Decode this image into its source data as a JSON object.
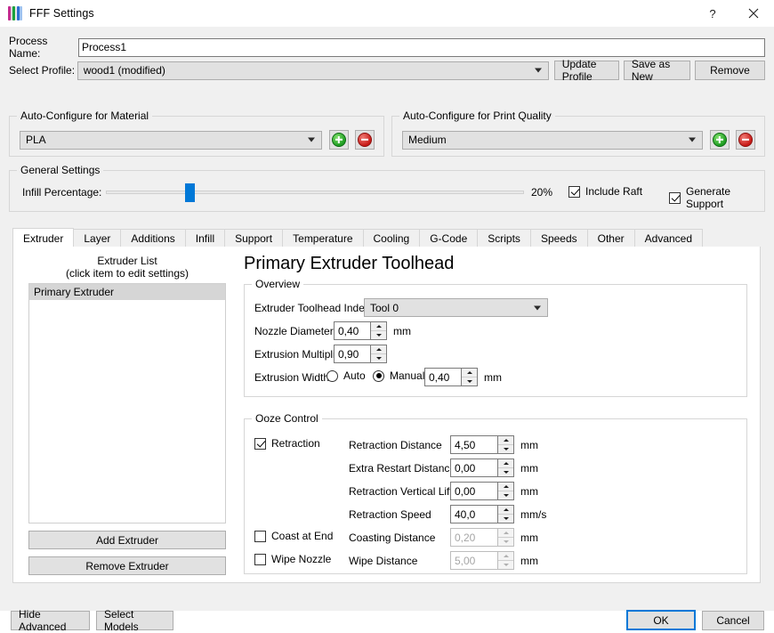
{
  "window": {
    "title": "FFF Settings",
    "app_icon": "fff-stripes-icon",
    "help_label": "?",
    "close_label": "✕"
  },
  "header": {
    "process_name_label": "Process Name:",
    "process_name_value": "Process1",
    "select_profile_label": "Select Profile:",
    "select_profile_value": "wood1 (modified)",
    "update_profile_label": "Update Profile",
    "save_as_new_label": "Save as New",
    "remove_label": "Remove"
  },
  "material_group": {
    "legend": "Auto-Configure for Material",
    "value": "PLA",
    "add_label": "+",
    "remove_label": "−"
  },
  "quality_group": {
    "legend": "Auto-Configure for Print Quality",
    "value": "Medium",
    "add_label": "+",
    "remove_label": "−"
  },
  "general_group": {
    "legend": "General Settings",
    "infill_label": "Infill Percentage:",
    "infill_value": "20%",
    "infill_percent": 20,
    "include_raft_label": "Include Raft",
    "include_raft_checked": true,
    "generate_support_label": "Generate Support",
    "generate_support_checked": true
  },
  "tabs": [
    {
      "label": "Extruder",
      "active": true
    },
    {
      "label": "Layer",
      "active": false
    },
    {
      "label": "Additions",
      "active": false
    },
    {
      "label": "Infill",
      "active": false
    },
    {
      "label": "Support",
      "active": false
    },
    {
      "label": "Temperature",
      "active": false
    },
    {
      "label": "Cooling",
      "active": false
    },
    {
      "label": "G-Code",
      "active": false
    },
    {
      "label": "Scripts",
      "active": false
    },
    {
      "label": "Speeds",
      "active": false
    },
    {
      "label": "Other",
      "active": false
    },
    {
      "label": "Advanced",
      "active": false
    }
  ],
  "extruder_list": {
    "title": "Extruder List",
    "subtitle": "(click item to edit settings)",
    "items": [
      {
        "label": "Primary Extruder",
        "selected": true
      }
    ],
    "add_label": "Add Extruder",
    "remove_label": "Remove Extruder"
  },
  "panel": {
    "title": "Primary Extruder Toolhead",
    "overview": {
      "legend": "Overview",
      "toolhead_index_label": "Extruder Toolhead Index",
      "toolhead_index_value": "Tool 0",
      "nozzle_diameter_label": "Nozzle Diameter",
      "nozzle_diameter_value": "0,40",
      "nozzle_diameter_unit": "mm",
      "extrusion_multiplier_label": "Extrusion Multiplier",
      "extrusion_multiplier_value": "0,90",
      "extrusion_width_label": "Extrusion Width",
      "extrusion_width_auto_label": "Auto",
      "extrusion_width_manual_label": "Manual",
      "extrusion_width_mode": "Manual",
      "extrusion_width_value": "0,40",
      "extrusion_width_unit": "mm"
    },
    "ooze": {
      "legend": "Ooze Control",
      "retraction_label": "Retraction",
      "retraction_checked": true,
      "retraction_distance_label": "Retraction Distance",
      "retraction_distance_value": "4,50",
      "retraction_distance_unit": "mm",
      "extra_restart_label": "Extra Restart Distance",
      "extra_restart_value": "0,00",
      "extra_restart_unit": "mm",
      "vertical_lift_label": "Retraction Vertical Lift",
      "vertical_lift_value": "0,00",
      "vertical_lift_unit": "mm",
      "retraction_speed_label": "Retraction Speed",
      "retraction_speed_value": "40,0",
      "retraction_speed_unit": "mm/s",
      "coast_at_end_label": "Coast at End",
      "coast_at_end_checked": false,
      "coasting_distance_label": "Coasting Distance",
      "coasting_distance_value": "0,20",
      "coasting_distance_unit": "mm",
      "coasting_distance_enabled": false,
      "wipe_nozzle_label": "Wipe Nozzle",
      "wipe_nozzle_checked": false,
      "wipe_distance_label": "Wipe Distance",
      "wipe_distance_value": "5,00",
      "wipe_distance_unit": "mm",
      "wipe_distance_enabled": false
    }
  },
  "footer": {
    "hide_advanced_label": "Hide Advanced",
    "select_models_label": "Select Models",
    "ok_label": "OK",
    "cancel_label": "Cancel"
  },
  "colors": {
    "accent": "#0078d7",
    "dialog_bg": "#f0f0f0",
    "panel_bg": "#ffffff",
    "selection": "#d6d6d6",
    "add_green": "#1f9d23",
    "remove_red": "#c81b18"
  }
}
